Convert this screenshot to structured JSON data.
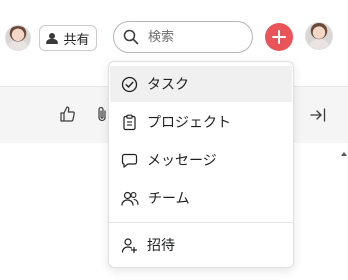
{
  "header": {
    "share_label": "共有",
    "search_placeholder": "検索"
  },
  "menu": {
    "items": [
      {
        "label": "タスク",
        "icon": "check-circle-icon"
      },
      {
        "label": "プロジェクト",
        "icon": "clipboard-icon"
      },
      {
        "label": "メッセージ",
        "icon": "chat-bubble-icon"
      },
      {
        "label": "チーム",
        "icon": "people-icon"
      }
    ],
    "invite_label": "招待",
    "invite_icon": "person-plus-icon"
  },
  "colors": {
    "accent": "#e8545a"
  }
}
